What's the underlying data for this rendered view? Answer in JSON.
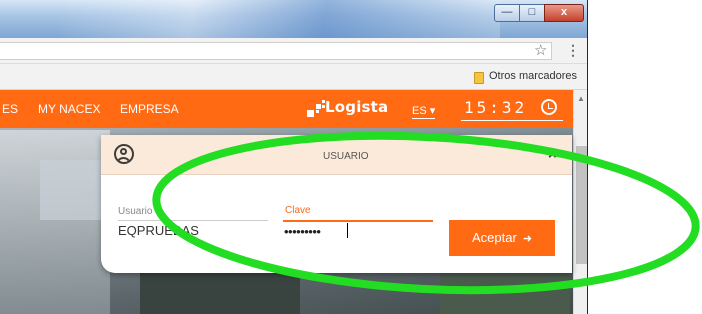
{
  "colors": {
    "accent": "#ff6a13",
    "highlight": "#22dd22"
  },
  "window": {
    "min_glyph": "—",
    "max_glyph": "□",
    "close_glyph": "x"
  },
  "toolbar": {
    "star_icon": "star-icon",
    "menu_glyph": "⋮",
    "star_glyph": "☆"
  },
  "bookmarks": {
    "folder_label": "Otros marcadores"
  },
  "nav": {
    "items": [
      {
        "label": "ES"
      },
      {
        "label": "MY NACEX"
      },
      {
        "label": "EMPRESA"
      }
    ]
  },
  "logo": {
    "text": "Logista"
  },
  "language": {
    "value": "ES ▾"
  },
  "clock": {
    "time": "15:32"
  },
  "login": {
    "title": "USUARIO",
    "close_glyph": "×",
    "user_label": "Usuario",
    "user_value": "EQPRUEBAS",
    "password_label": "Clave",
    "password_value": "•••••••••",
    "submit_label": "Aceptar",
    "submit_icon": "sign-in-icon"
  }
}
